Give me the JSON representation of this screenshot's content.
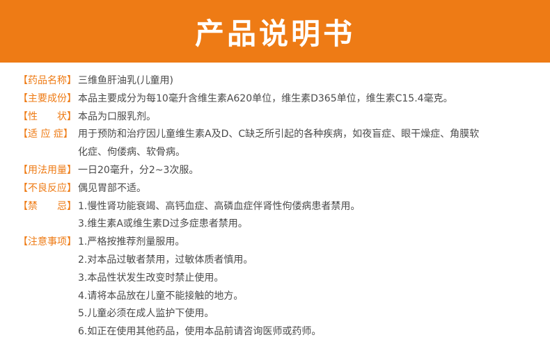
{
  "title": "产品说明书",
  "rows": [
    {
      "label": "【药品名称】",
      "lines": [
        "三维鱼肝油乳(儿童用)"
      ]
    },
    {
      "label": "【主要成份】",
      "lines": [
        "本品主要成分为每10毫升含维生素A620单位，维生素D365单位，维生素C15.4毫克。"
      ]
    },
    {
      "label": "【性　　状】",
      "lines": [
        "本品为口服乳剂。"
      ]
    },
    {
      "label": "【适 应 症】",
      "lines": [
        "用于预防和治疗因儿童维生素A及D、C缺乏所引起的各种疾病，如夜盲症、眼干燥症、角膜软",
        "化症、佝偻病、软骨病。"
      ]
    },
    {
      "label": "【用法用量】",
      "lines": [
        "一日20毫升，分2~3次服。"
      ]
    },
    {
      "label": "【不良反应】",
      "lines": [
        "偶见胃部不适。"
      ]
    },
    {
      "label": "【禁　　忌】",
      "lines": [
        "1.慢性肾功能衰竭、高钙血症、高磷血症伴肾性佝偻病患者禁用。",
        "3.维生素A或维生素D过多症患者禁用。"
      ]
    },
    {
      "label": "【注意事项】",
      "lines": [
        "1.严格按推荐剂量服用。",
        "2.对本品过敏者禁用，过敏体质者慎用。",
        "3.本品性状发生改变时禁止使用。",
        "4.请将本品放在儿童不能接触的地方。",
        "5.儿童必须在成人监护下使用。",
        "6.如正在使用其他药品，使用本品前请咨询医师或药师。"
      ]
    }
  ]
}
